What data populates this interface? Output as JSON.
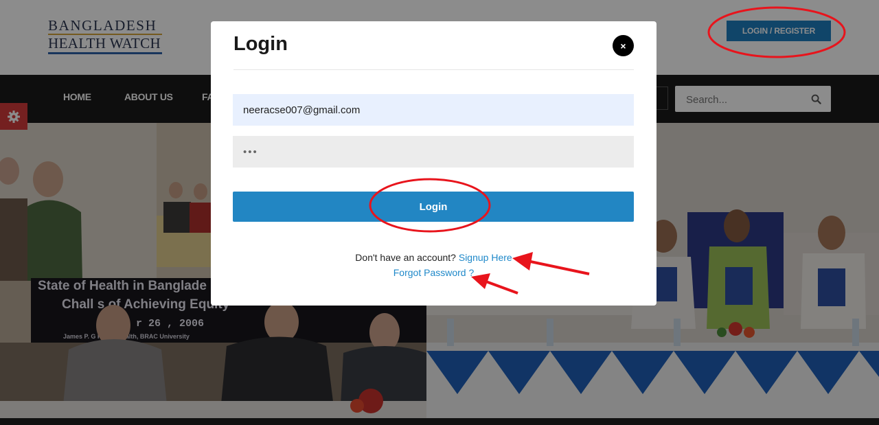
{
  "header": {
    "logo_line1": "BANGLADESH",
    "logo_line2": "HEALTH WATCH",
    "login_register": "LOGIN / REGISTER"
  },
  "nav": {
    "items": [
      "HOME",
      "ABOUT US",
      "FA"
    ],
    "search_placeholder": "Search..."
  },
  "hero": {
    "banner_line1": "State of Health in Banglade",
    "banner_line2": "Chall    s of Achieving Equity",
    "banner_date": "r 26 , 2006",
    "banner_sub": "James P. G     Public Health, BRAC University"
  },
  "modal": {
    "title": "Login",
    "close": "×",
    "email_value": "neeracse007@gmail.com",
    "password_mask": "•••",
    "login_label": "Login",
    "no_account_text": "Don't have an account?",
    "signup_link": "Signup Here",
    "forgot_link": "Forgot Password ?"
  },
  "colors": {
    "accent": "#2286c3",
    "annotation": "#e8141c",
    "nav_bg": "#1b1b1b",
    "settings_tab": "#d33b3b"
  },
  "icons": {
    "search": "search-icon",
    "settings": "gear-icon",
    "close": "close-icon"
  }
}
